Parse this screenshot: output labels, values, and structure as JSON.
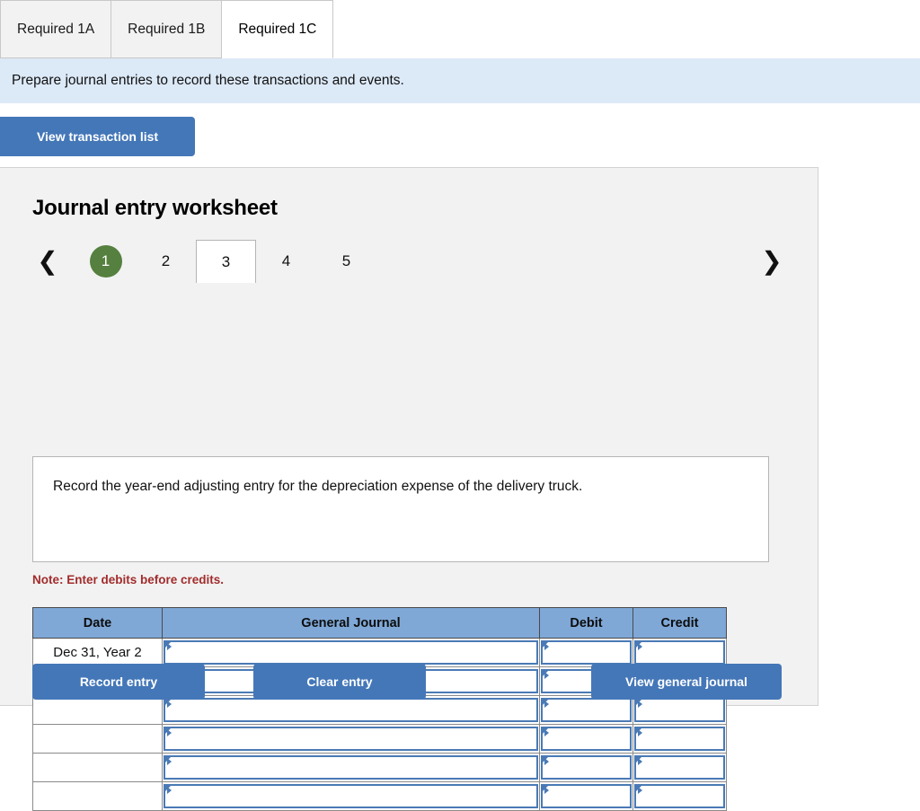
{
  "requirement_tabs": [
    {
      "label": "Required 1A",
      "active": false
    },
    {
      "label": "Required 1B",
      "active": false
    },
    {
      "label": "Required 1C",
      "active": true
    }
  ],
  "instruction": "Prepare journal entries to record these transactions and events.",
  "transaction_list_button": "View transaction list",
  "worksheet": {
    "title": "Journal entry worksheet",
    "pager": {
      "prev_icon": "chevron-left-icon",
      "next_icon": "chevron-right-icon",
      "items": [
        {
          "label": "1",
          "state": "completed"
        },
        {
          "label": "2",
          "state": "default"
        },
        {
          "label": "3",
          "state": "active"
        },
        {
          "label": "4",
          "state": "default"
        },
        {
          "label": "5",
          "state": "default"
        }
      ]
    },
    "description": "Record the year-end adjusting entry for the depreciation expense of the delivery truck.",
    "note": "Note: Enter debits before credits.",
    "table": {
      "headers": [
        "Date",
        "General Journal",
        "Debit",
        "Credit"
      ],
      "rows": [
        {
          "date": "Dec 31, Year 2",
          "general_journal": "",
          "debit": "",
          "credit": ""
        },
        {
          "date": "",
          "general_journal": "",
          "debit": "",
          "credit": ""
        },
        {
          "date": "",
          "general_journal": "",
          "debit": "",
          "credit": ""
        },
        {
          "date": "",
          "general_journal": "",
          "debit": "",
          "credit": ""
        },
        {
          "date": "",
          "general_journal": "",
          "debit": "",
          "credit": ""
        },
        {
          "date": "",
          "general_journal": "",
          "debit": "",
          "credit": ""
        }
      ]
    },
    "actions": {
      "record_entry": "Record entry",
      "clear_entry": "Clear entry",
      "view_general_journal": "View general journal"
    }
  },
  "colors": {
    "button_blue": "#4477b8",
    "header_blue": "#7fa8d7",
    "instruction_blue": "#dce9f7",
    "badge_green": "#55803f",
    "note_red": "#a22c2c",
    "input_border": "#4a7ab5",
    "panel_gray": "#f2f2f2"
  }
}
